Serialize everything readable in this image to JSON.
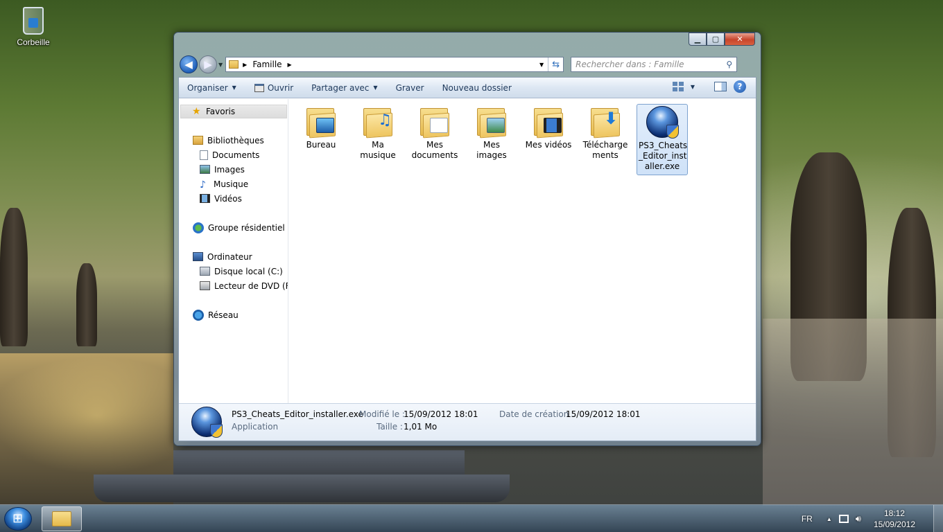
{
  "desktop": {
    "recycle_bin_label": "Corbeille"
  },
  "window": {
    "caption_buttons": {
      "minimize": "▁",
      "maximize": "▢",
      "close": "✕"
    },
    "address": {
      "breadcrumb": "Famille"
    },
    "search": {
      "placeholder": "Rechercher dans : Famille"
    },
    "toolbar": {
      "organize": "Organiser",
      "open": "Ouvrir",
      "share": "Partager avec",
      "burn": "Graver",
      "new_folder": "Nouveau dossier",
      "help": "?"
    },
    "nav_pane": {
      "favorites": "Favoris",
      "libraries": "Bibliothèques",
      "documents": "Documents",
      "images": "Images",
      "music": "Musique",
      "videos": "Vidéos",
      "homegroup": "Groupe résidentiel",
      "computer": "Ordinateur",
      "local_disk": "Disque local (C:)",
      "dvd_drive": "Lecteur de DVD (F:) I",
      "network": "Réseau"
    },
    "files": [
      {
        "line1": "Bureau",
        "line2": "",
        "line3": "",
        "icon": "folder-desktop-icon"
      },
      {
        "line1": "Ma",
        "line2": "musique",
        "line3": "",
        "icon": "folder-music-icon"
      },
      {
        "line1": "Mes",
        "line2": "documents",
        "line3": "",
        "icon": "folder-documents-icon"
      },
      {
        "line1": "Mes",
        "line2": "images",
        "line3": "",
        "icon": "folder-pictures-icon"
      },
      {
        "line1": "Mes vidéos",
        "line2": "",
        "line3": "",
        "icon": "folder-videos-icon"
      },
      {
        "line1": "Télécharge",
        "line2": "ments",
        "line3": "",
        "icon": "folder-downloads-icon"
      },
      {
        "line1": "PS3_Cheats",
        "line2": "_Editor_inst",
        "line3": "aller.exe",
        "icon": "installer-exe-icon",
        "selected": true
      }
    ],
    "details": {
      "name": "PS3_Cheats_Editor_installer.exe",
      "type": "Application",
      "modified_label": "Modifié le :",
      "modified_value": "15/09/2012 18:01",
      "size_label": "Taille :",
      "size_value": "1,01 Mo",
      "created_label": "Date de création :",
      "created_value": "15/09/2012 18:01"
    }
  },
  "taskbar": {
    "language": "FR",
    "time": "18:12",
    "date": "15/09/2012"
  }
}
